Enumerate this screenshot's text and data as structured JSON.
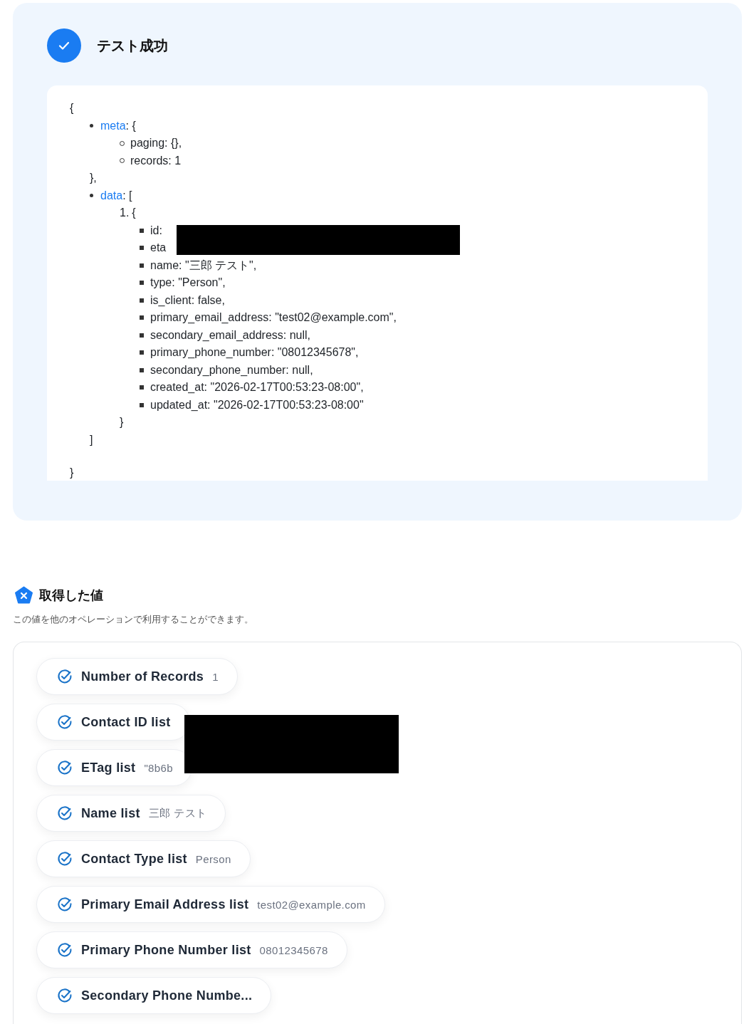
{
  "result": {
    "title": "テスト成功",
    "code": {
      "open": "{",
      "close": "}",
      "items": [
        {
          "kind": "disc",
          "key": "meta",
          "text": ": {",
          "close": "},",
          "children": [
            {
              "kind": "circle",
              "text": "paging: {},"
            },
            {
              "kind": "circle",
              "text": "records: 1"
            }
          ]
        },
        {
          "kind": "disc",
          "key": "data",
          "text": ": [",
          "close": "]",
          "children": [
            {
              "kind": "number",
              "marker": "1.",
              "text": "{",
              "close": "}",
              "children": [
                {
                  "kind": "square",
                  "text": "id:"
                },
                {
                  "kind": "square",
                  "text": "eta"
                },
                {
                  "kind": "square",
                  "text": "name: \"三郎 テスト\","
                },
                {
                  "kind": "square",
                  "text": "type: \"Person\","
                },
                {
                  "kind": "square",
                  "text": "is_client: false,"
                },
                {
                  "kind": "square",
                  "text": "primary_email_address: \"test02@example.com\","
                },
                {
                  "kind": "square",
                  "text": "secondary_email_address: null,"
                },
                {
                  "kind": "square",
                  "text": "primary_phone_number: \"08012345678\","
                },
                {
                  "kind": "square",
                  "text": "secondary_phone_number: null,"
                },
                {
                  "kind": "square",
                  "text": "created_at: \"2026-02-17T00:53:23-08:00\","
                },
                {
                  "kind": "square",
                  "text": "updated_at: \"2026-02-17T00:53:23-08:00\""
                }
              ]
            }
          ]
        }
      ]
    }
  },
  "values": {
    "title": "取得した値",
    "description": "この値を他のオペレーションで利用することができます。",
    "items": [
      {
        "label": "Number of Records",
        "value": "1"
      },
      {
        "label": "Contact ID list"
      },
      {
        "label": "ETag list",
        "value": "\"8b6b"
      },
      {
        "label": "Name list",
        "value": "三郎 テスト"
      },
      {
        "label": "Contact Type list",
        "value": "Person"
      },
      {
        "label": "Primary Email Address list",
        "value": "test02@example.com"
      },
      {
        "label": "Primary Phone Number list",
        "value": "08012345678"
      },
      {
        "label": "Secondary Phone Numbe..."
      }
    ]
  }
}
